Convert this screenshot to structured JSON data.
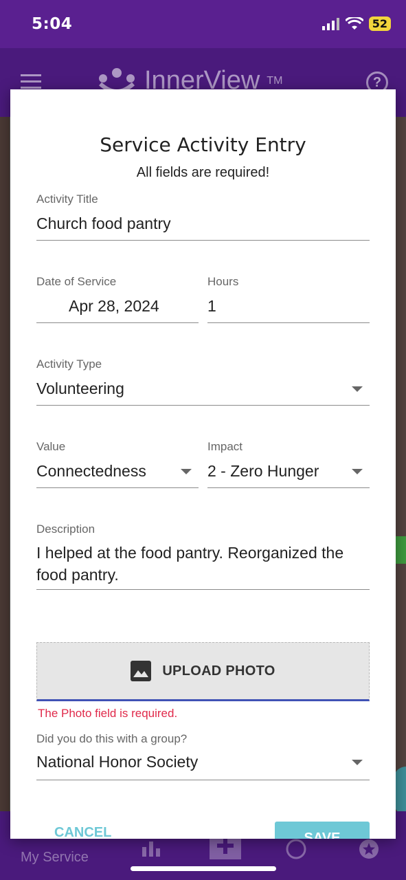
{
  "status_bar": {
    "time": "5:04",
    "battery": "52"
  },
  "app_bar": {
    "brand": "InnerView",
    "trademark": "TM",
    "help": "?"
  },
  "bottom_nav": {
    "my_service": "My Service"
  },
  "dialog": {
    "title": "Service Activity Entry",
    "subtitle": "All fields are required!",
    "activity_title": {
      "label": "Activity Title",
      "value": "Church food pantry"
    },
    "date_of_service": {
      "label": "Date of Service",
      "value": "Apr 28, 2024"
    },
    "hours": {
      "label": "Hours",
      "value": "1"
    },
    "activity_type": {
      "label": "Activity Type",
      "value": "Volunteering"
    },
    "value": {
      "label": "Value",
      "value": "Connectedness"
    },
    "impact": {
      "label": "Impact",
      "value": "2 - Zero Hunger"
    },
    "description": {
      "label": "Description",
      "value": "I helped at the food pantry. Reorganized the food pantry."
    },
    "upload": {
      "label": "UPLOAD PHOTO",
      "error": "The Photo field is required."
    },
    "group": {
      "label": "Did you do this with a group?",
      "value": "National Honor Society"
    },
    "cancel_label": "CANCEL",
    "save_label": "SAVE"
  },
  "colors": {
    "brand_purple": "#5a2090",
    "accent_teal": "#6ec8d6",
    "error_red": "#e0294a",
    "focus_blue": "#4052b5"
  }
}
